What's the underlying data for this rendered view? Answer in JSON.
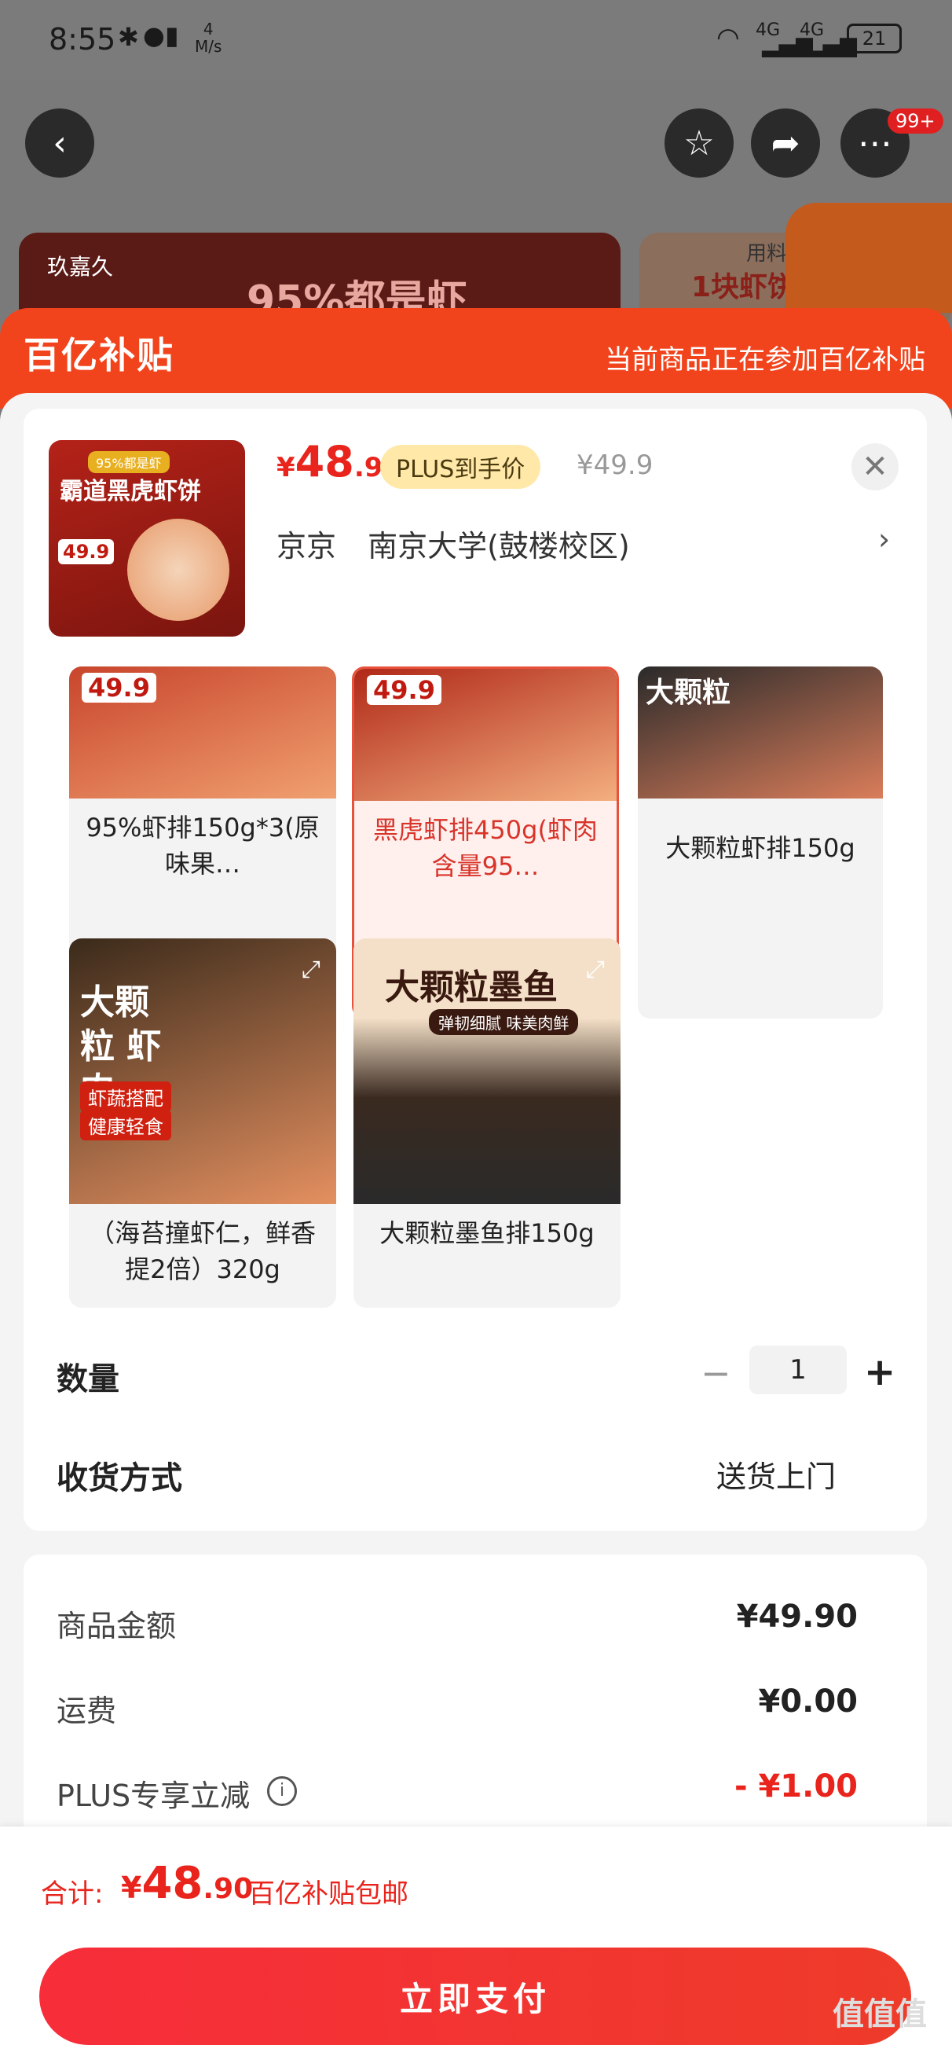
{
  "status_bar": {
    "time": "8:55",
    "net_speed_value": "4",
    "net_speed_unit": "M/s",
    "battery": "21",
    "network": "4G"
  },
  "nav": {
    "badge": "99+"
  },
  "background_banner": {
    "brand": "玖嘉久",
    "headline": "95%都是虾",
    "side_text": "1块虾饼",
    "side_top": "用料够"
  },
  "subsidy": {
    "logo": "百亿补贴",
    "notice": "当前商品正在参加百亿补贴"
  },
  "product": {
    "price_symbol": "¥",
    "price_int": "48",
    "price_dec": ".9",
    "plus_tag": "PLUS到手价",
    "orig_price": "¥49.9",
    "thumb_title": "霸道黑虎虾饼",
    "thumb_tag": "95%都是虾",
    "thumb_price": "49.9"
  },
  "address": {
    "city": "京京",
    "detail": "南京大学(鼓楼校区)"
  },
  "options": [
    {
      "label": "95%虾排150g*3(原味果…",
      "badge_price": "49.9"
    },
    {
      "label": "黑虎虾排450g(虾肉含量95…",
      "badge_price": "49.9",
      "selected": true
    },
    {
      "label": "大颗粒虾排150g",
      "img_text": "大颗粒"
    },
    {
      "label": "（海苔撞虾仁，鲜香提2倍）320g",
      "img_text": "大颗粒 虾肉",
      "img_tags": [
        "虾蔬搭配",
        "健康轻食"
      ]
    },
    {
      "label": "大颗粒墨鱼排150g",
      "img_text": "大颗粒墨鱼",
      "img_sub": "弹韧细腻 味美肉鲜"
    }
  ],
  "quantity": {
    "label": "数量",
    "minus": "−",
    "value": "1",
    "plus": "+"
  },
  "shipping": {
    "label": "收货方式",
    "value": "送货上门"
  },
  "summary": {
    "goods_label": "商品金额",
    "goods_value": "¥49.90",
    "freight_label": "运费",
    "freight_value": "¥0.00",
    "plus_label": "PLUS专享立减",
    "plus_value": "- ¥1.00"
  },
  "footer": {
    "total_label": "合计:",
    "total_symbol": "¥",
    "total_int": "48",
    "total_dec": ".90",
    "note": "百亿补贴包邮",
    "pay": "立即支付"
  },
  "watermark": "值值值",
  "colors": {
    "accent": "#e8241c",
    "subsidy": "#f2441c",
    "plus_tag": "#ffe8a8"
  }
}
